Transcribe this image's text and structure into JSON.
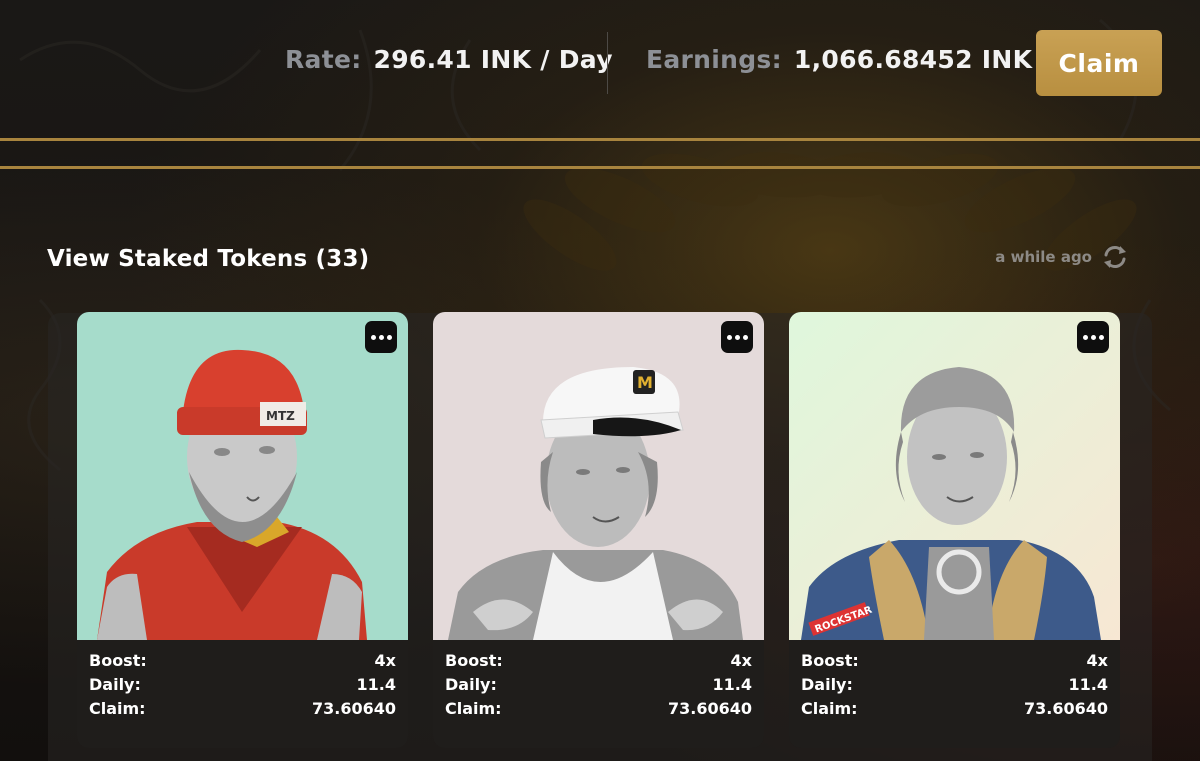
{
  "stats": {
    "rate_label": "Rate:",
    "rate_value": "296.41 INK / Day",
    "earnings_label": "Earnings:",
    "earnings_value": "1,066.68452 INK",
    "claim_label": "Claim"
  },
  "section": {
    "title": "View Staked Tokens (33)",
    "updated_text": "a while ago"
  },
  "labels": {
    "boost": "Boost:",
    "daily": "Daily:",
    "claim": "Claim:"
  },
  "tokens": [
    {
      "boost": "4x",
      "daily": "11.4",
      "claim": "73.60640",
      "background": "#a6dccb",
      "outfit": "red hoodie with red beanie",
      "menu_icon": "more-dots-icon"
    },
    {
      "boost": "4x",
      "daily": "11.4",
      "claim": "73.60640",
      "background": "#e4dada",
      "outfit": "captain hat with torn shirt",
      "hat_text": "M",
      "menu_icon": "more-dots-icon"
    },
    {
      "boost": "4x",
      "daily": "11.4",
      "claim": "73.60640",
      "background": "#def5dc",
      "outfit": "denim jacket with fur collar",
      "jacket_text": "ROCKSTAR",
      "menu_icon": "more-dots-icon"
    }
  ],
  "colors": {
    "accent_gold": "#bf9849",
    "gold_line": "#a8843e",
    "muted_text": "#8d9096"
  },
  "icons": {
    "refresh": "refresh-icon",
    "menu": "more-dots-icon"
  }
}
